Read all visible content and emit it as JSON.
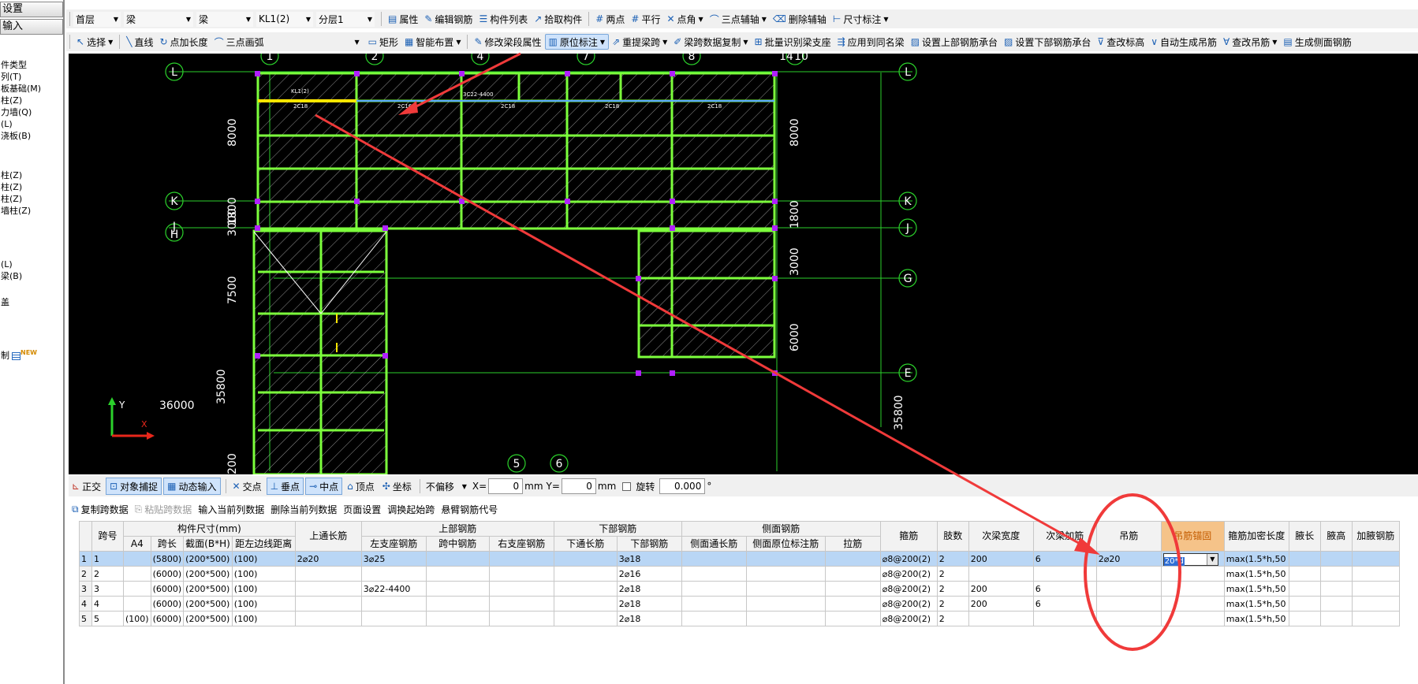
{
  "left_panel": {
    "buttons": [
      "设置",
      "输入"
    ],
    "items": [
      "件类型",
      "列(T)",
      "板基础(M)",
      "柱(Z)",
      "力墙(Q)",
      "(L)",
      "浇板(B)",
      "柱(Z)",
      "柱(Z)",
      "柱(Z)",
      "墙柱(Z)",
      "(L)",
      "梁(B)",
      "盖",
      "制"
    ],
    "new_badge": "NEW"
  },
  "toolbar1": {
    "floor": "首层",
    "category": "梁",
    "subcategory": "梁",
    "component": "KL1(2)",
    "layer": "分层1",
    "items": [
      "属性",
      "编辑钢筋",
      "构件列表",
      "拾取构件",
      "两点",
      "平行",
      "点角",
      "三点辅轴",
      "删除辅轴",
      "尺寸标注"
    ]
  },
  "toolbar2": {
    "items": [
      "选择",
      "直线",
      "点加长度",
      "三点画弧",
      "矩形",
      "智能布置",
      "修改梁段属性",
      "原位标注",
      "重提梁跨",
      "梁跨数据复制",
      "批量识别梁支座",
      "应用到同名梁",
      "设置上部钢筋承台",
      "设置下部钢筋承台",
      "查改标高",
      "自动生成吊筋",
      "查改吊筋",
      "生成侧面钢筋"
    ],
    "active": "原位标注"
  },
  "canvas": {
    "axes_top": [
      "1",
      "2",
      "4",
      "7",
      "8",
      "14",
      "10"
    ],
    "axes_bottom": [
      "5",
      "6"
    ],
    "axes_left": [
      "L",
      "K",
      "J",
      "H"
    ],
    "axes_right": [
      "L",
      "K",
      "J",
      "G",
      "E"
    ],
    "dims_left": [
      "8000",
      "3000",
      "1800",
      "7500",
      "35800",
      "200"
    ],
    "dims_right": [
      "8000",
      "1800",
      "3000",
      "6000",
      "35800"
    ],
    "label_36000": "36000",
    "ucs_y": "Y",
    "ucs_x": "X",
    "beam_texts": [
      "KL1(2)",
      "2C18",
      "2C16",
      "2C18",
      "2C18",
      "2C18",
      "3C22-4400"
    ]
  },
  "status_bar": {
    "items": [
      "正交",
      "对象捕捉",
      "动态输入",
      "交点",
      "垂点",
      "中点",
      "顶点",
      "坐标"
    ],
    "offset_mode": "不偏移",
    "x_label": "X=",
    "x_value": "0",
    "y_label": "Y=",
    "y_value": "0",
    "unit": "mm",
    "rotate_label": "旋转",
    "rotate_value": "0.000",
    "degree": "°"
  },
  "grid_toolbar": {
    "items": [
      "复制跨数据",
      "粘贴跨数据",
      "输入当前列数据",
      "删除当前列数据",
      "页面设置",
      "调换起始跨",
      "悬臂钢筋代号"
    ]
  },
  "table": {
    "group_headers": {
      "span": "跨号",
      "size": "构件尺寸(mm)",
      "top_through": "上通长筋",
      "top_rebar": "上部钢筋",
      "bottom_rebar": "下部钢筋",
      "side_rebar": "侧面钢筋",
      "stirrup": "箍筋",
      "legs": "肢数",
      "sec_width": "次梁宽度",
      "sec_add": "次梁加筋",
      "hanger": "吊筋",
      "hanger_anchor": "吊筋锚固",
      "stirrup_dense": "箍筋加密长度",
      "haunch_len": "腋长",
      "haunch_h": "腋高",
      "haunch_rebar": "加腋钢筋"
    },
    "sub_headers": [
      "A4",
      "跨长",
      "截面(B*H)",
      "距左边线距离",
      "左支座钢筋",
      "跨中钢筋",
      "右支座钢筋",
      "下通长筋",
      "下部钢筋",
      "侧面通长筋",
      "侧面原位标注筋",
      "拉筋"
    ],
    "rows": [
      {
        "rn": "1",
        "span": "1",
        "a4": "",
        "len": "(5800)",
        "sec": "(200*500)",
        "dist": "(100)",
        "top": "2⌀20",
        "left": "3⌀25",
        "mid": "",
        "right": "",
        "btm_through": "",
        "btm": "3⌀18",
        "side_through": "",
        "side_in": "",
        "tie": "",
        "stirrup": "⌀8@200(2)",
        "legs": "2",
        "sec_width": "200",
        "sec_add": "6",
        "hanger": "2⌀20",
        "anchor": "20*d",
        "dense": "max(1.5*h,50"
      },
      {
        "rn": "2",
        "span": "2",
        "a4": "",
        "len": "(6000)",
        "sec": "(200*500)",
        "dist": "(100)",
        "top": "",
        "left": "",
        "mid": "",
        "right": "",
        "btm_through": "",
        "btm": "2⌀16",
        "side_through": "",
        "side_in": "",
        "tie": "",
        "stirrup": "⌀8@200(2)",
        "legs": "2",
        "sec_width": "",
        "sec_add": "",
        "hanger": "",
        "anchor": "",
        "dense": "max(1.5*h,50"
      },
      {
        "rn": "3",
        "span": "3",
        "a4": "",
        "len": "(6000)",
        "sec": "(200*500)",
        "dist": "(100)",
        "top": "",
        "left": "3⌀22-4400",
        "mid": "",
        "right": "",
        "btm_through": "",
        "btm": "2⌀18",
        "side_through": "",
        "side_in": "",
        "tie": "",
        "stirrup": "⌀8@200(2)",
        "legs": "2",
        "sec_width": "200",
        "sec_add": "6",
        "hanger": "",
        "anchor": "",
        "dense": "max(1.5*h,50"
      },
      {
        "rn": "4",
        "span": "4",
        "a4": "",
        "len": "(6000)",
        "sec": "(200*500)",
        "dist": "(100)",
        "top": "",
        "left": "",
        "mid": "",
        "right": "",
        "btm_through": "",
        "btm": "2⌀18",
        "side_through": "",
        "side_in": "",
        "tie": "",
        "stirrup": "⌀8@200(2)",
        "legs": "2",
        "sec_width": "200",
        "sec_add": "6",
        "hanger": "",
        "anchor": "",
        "dense": "max(1.5*h,50"
      },
      {
        "rn": "5",
        "span": "5",
        "a4": "(100)",
        "len": "(6000)",
        "sec": "(200*500)",
        "dist": "(100)",
        "top": "",
        "left": "",
        "mid": "",
        "right": "",
        "btm_through": "",
        "btm": "2⌀18",
        "side_through": "",
        "side_in": "",
        "tie": "",
        "stirrup": "⌀8@200(2)",
        "legs": "2",
        "sec_width": "",
        "sec_add": "",
        "hanger": "",
        "anchor": "",
        "dense": "max(1.5*h,50"
      }
    ]
  },
  "colors": {
    "canvas_bg": "#000000",
    "beam_green": "#7cff3c",
    "axis_green": "#2bd12b",
    "selected_beam": "#ffe600",
    "annotation_red": "#f03a3a",
    "column_magenta": "#b020ff",
    "selected_row": "#b9d6f5",
    "active_header": "#f5c389"
  }
}
